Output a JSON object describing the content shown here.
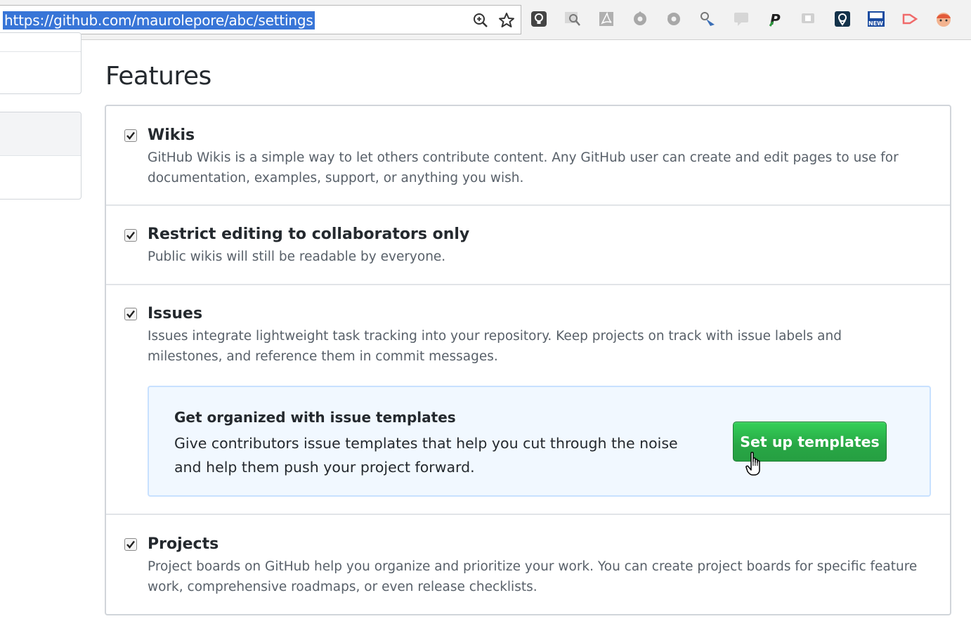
{
  "browser": {
    "url": "https://github.com/maurolepore/abc/settings",
    "url_icons": [
      "zoom-icon",
      "star-bookmark-icon"
    ],
    "extensions": [
      {
        "name": "lightbulb-extension-icon",
        "color": "#444444"
      },
      {
        "name": "search-image-extension-icon",
        "color": "#9a9a9a"
      },
      {
        "name": "pdf-extension-icon",
        "color": "#a0a0a0"
      },
      {
        "name": "gear-extension-icon",
        "color": "#a0a0a0"
      },
      {
        "name": "gear-grey-extension-icon",
        "color": "#a0a0a0"
      },
      {
        "name": "inspector-extension-icon",
        "color": "#3b6fb6"
      },
      {
        "name": "comment-extension-icon",
        "color": "#c8c8c8"
      },
      {
        "name": "paypal-extension-icon",
        "color": "#1e5a2e"
      },
      {
        "name": "video-extension-icon",
        "color": "#c8c8c8"
      },
      {
        "name": "location-pin-extension-icon",
        "color": "#13324a"
      },
      {
        "name": "new-badge-extension-icon",
        "color": "#1a4ba0"
      },
      {
        "name": "play-extension-icon",
        "color": "#f06a6a"
      },
      {
        "name": "face-extension-icon",
        "color": "#e25a3a"
      }
    ]
  },
  "page": {
    "heading": "Features"
  },
  "features": [
    {
      "title": "Wikis",
      "checked": true,
      "description": "GitHub Wikis is a simple way to let others contribute content. Any GitHub user can create and edit pages to use for documentation, examples, support, or anything you wish."
    },
    {
      "title": "Restrict editing to collaborators only",
      "checked": true,
      "description": "Public wikis will still be readable by everyone."
    },
    {
      "title": "Issues",
      "checked": true,
      "description": "Issues integrate lightweight task tracking into your repository. Keep projects on track with issue labels and milestones, and reference them in commit messages."
    },
    {
      "title": "Projects",
      "checked": true,
      "description": "Project boards on GitHub help you organize and prioritize your work. You can create project boards for specific feature work, comprehensive roadmaps, or even release checklists."
    }
  ],
  "templates": {
    "title": "Get organized with issue templates",
    "description": "Give contributors issue templates that help you cut through the noise and help them push your project forward.",
    "button_label": "Set up templates",
    "button_color": "#28a745"
  }
}
